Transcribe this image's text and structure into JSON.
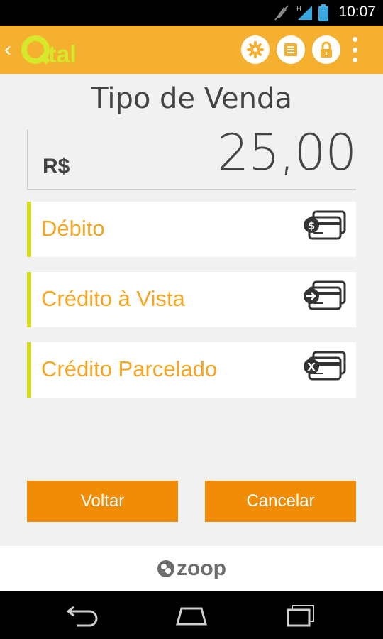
{
  "status_bar": {
    "time": "10:07",
    "icons": [
      "mute-icon",
      "signal-icon",
      "battery-icon"
    ]
  },
  "action_bar": {
    "logo_text": "Qtal",
    "actions": [
      "settings-icon",
      "list-icon",
      "lock-icon",
      "overflow-menu-icon"
    ]
  },
  "page": {
    "title": "Tipo de Venda",
    "currency": "R$",
    "amount": "25,00"
  },
  "options": [
    {
      "label": "Débito",
      "icon": "debit-card-icon"
    },
    {
      "label": "Crédito à Vista",
      "icon": "credit-single-card-icon"
    },
    {
      "label": "Crédito Parcelado",
      "icon": "credit-installment-card-icon"
    }
  ],
  "buttons": {
    "back": "Voltar",
    "cancel": "Cancelar"
  },
  "footer": {
    "brand": "zoop"
  },
  "colors": {
    "accent": "#f5b030",
    "button": "#f08c05",
    "option_text": "#f5a623",
    "option_border": "#d6dc1c"
  }
}
